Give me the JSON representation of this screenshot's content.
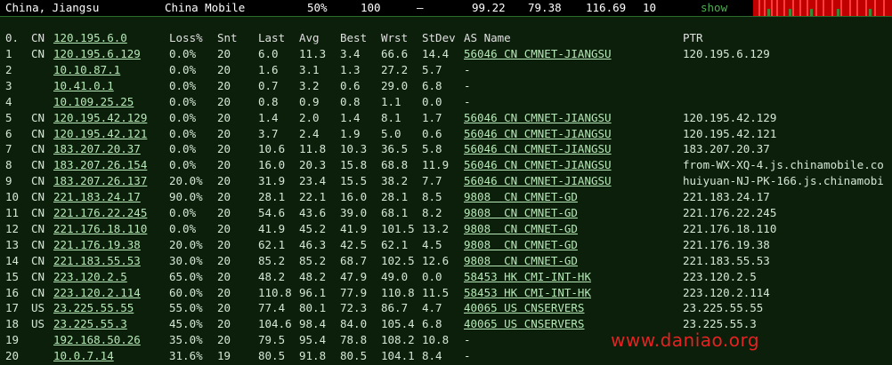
{
  "header": {
    "location": "China, Jiangsu",
    "isp": "China Mobile",
    "loss": "50%",
    "sent": "100",
    "dash": "–",
    "best": "99.22",
    "avg": "79.38",
    "worst": "116.69",
    "hops": "10",
    "show_label": "show"
  },
  "columns": [
    "0.",
    "CN",
    "120.195.6.0",
    "Loss%",
    "Snt",
    "Last",
    "Avg",
    "Best",
    "Wrst",
    "StDev",
    "AS Name",
    "PTR"
  ],
  "rows": [
    {
      "n": "1",
      "cc": "CN",
      "ip": "120.195.6.129",
      "loss": "0.0%",
      "snt": "20",
      "last": "6.0",
      "avg": "11.3",
      "best": "3.4",
      "wrst": "66.6",
      "stdev": "14.4",
      "as": "56046 CN CMNET-JIANGSU",
      "ptr": "120.195.6.129"
    },
    {
      "n": "2",
      "cc": "",
      "ip": "10.10.87.1",
      "loss": "0.0%",
      "snt": "20",
      "last": "1.6",
      "avg": "3.1",
      "best": "1.3",
      "wrst": "27.2",
      "stdev": "5.7",
      "as": "-",
      "ptr": ""
    },
    {
      "n": "3",
      "cc": "",
      "ip": "10.41.0.1",
      "loss": "0.0%",
      "snt": "20",
      "last": "0.7",
      "avg": "3.2",
      "best": "0.6",
      "wrst": "29.0",
      "stdev": "6.8",
      "as": "-",
      "ptr": ""
    },
    {
      "n": "4",
      "cc": "",
      "ip": "10.109.25.25",
      "loss": "0.0%",
      "snt": "20",
      "last": "0.8",
      "avg": "0.9",
      "best": "0.8",
      "wrst": "1.1",
      "stdev": "0.0",
      "as": "-",
      "ptr": ""
    },
    {
      "n": "5",
      "cc": "CN",
      "ip": "120.195.42.129",
      "loss": "0.0%",
      "snt": "20",
      "last": "1.4",
      "avg": "2.0",
      "best": "1.4",
      "wrst": "8.1",
      "stdev": "1.7",
      "as": "56046 CN CMNET-JIANGSU",
      "ptr": "120.195.42.129"
    },
    {
      "n": "6",
      "cc": "CN",
      "ip": "120.195.42.121",
      "loss": "0.0%",
      "snt": "20",
      "last": "3.7",
      "avg": "2.4",
      "best": "1.9",
      "wrst": "5.0",
      "stdev": "0.6",
      "as": "56046 CN CMNET-JIANGSU",
      "ptr": "120.195.42.121"
    },
    {
      "n": "7",
      "cc": "CN",
      "ip": "183.207.20.37",
      "loss": "0.0%",
      "snt": "20",
      "last": "10.6",
      "avg": "11.8",
      "best": "10.3",
      "wrst": "36.5",
      "stdev": "5.8",
      "as": "56046 CN CMNET-JIANGSU",
      "ptr": "183.207.20.37"
    },
    {
      "n": "8",
      "cc": "CN",
      "ip": "183.207.26.154",
      "loss": "0.0%",
      "snt": "20",
      "last": "16.0",
      "avg": "20.3",
      "best": "15.8",
      "wrst": "68.8",
      "stdev": "11.9",
      "as": "56046 CN CMNET-JIANGSU",
      "ptr": "from-WX-XQ-4.js.chinamobile.co"
    },
    {
      "n": "9",
      "cc": "CN",
      "ip": "183.207.26.137",
      "loss": "20.0%",
      "snt": "20",
      "last": "31.9",
      "avg": "23.4",
      "best": "15.5",
      "wrst": "38.2",
      "stdev": "7.7",
      "as": "56046 CN CMNET-JIANGSU",
      "ptr": "huiyuan-NJ-PK-166.js.chinamobi"
    },
    {
      "n": "10",
      "cc": "CN",
      "ip": "221.183.24.17",
      "loss": "90.0%",
      "snt": "20",
      "last": "28.1",
      "avg": "22.1",
      "best": "16.0",
      "wrst": "28.1",
      "stdev": "8.5",
      "as": "9808  CN CMNET-GD",
      "ptr": "221.183.24.17"
    },
    {
      "n": "11",
      "cc": "CN",
      "ip": "221.176.22.245",
      "loss": "0.0%",
      "snt": "20",
      "last": "54.6",
      "avg": "43.6",
      "best": "39.0",
      "wrst": "68.1",
      "stdev": "8.2",
      "as": "9808  CN CMNET-GD",
      "ptr": "221.176.22.245"
    },
    {
      "n": "12",
      "cc": "CN",
      "ip": "221.176.18.110",
      "loss": "0.0%",
      "snt": "20",
      "last": "41.9",
      "avg": "45.2",
      "best": "41.9",
      "wrst": "101.5",
      "stdev": "13.2",
      "as": "9808  CN CMNET-GD",
      "ptr": "221.176.18.110"
    },
    {
      "n": "13",
      "cc": "CN",
      "ip": "221.176.19.38",
      "loss": "20.0%",
      "snt": "20",
      "last": "62.1",
      "avg": "46.3",
      "best": "42.5",
      "wrst": "62.1",
      "stdev": "4.5",
      "as": "9808  CN CMNET-GD",
      "ptr": "221.176.19.38"
    },
    {
      "n": "14",
      "cc": "CN",
      "ip": "221.183.55.53",
      "loss": "30.0%",
      "snt": "20",
      "last": "85.2",
      "avg": "85.2",
      "best": "68.7",
      "wrst": "102.5",
      "stdev": "12.6",
      "as": "9808  CN CMNET-GD",
      "ptr": "221.183.55.53"
    },
    {
      "n": "15",
      "cc": "CN",
      "ip": "223.120.2.5",
      "loss": "65.0%",
      "snt": "20",
      "last": "48.2",
      "avg": "48.2",
      "best": "47.9",
      "wrst": "49.0",
      "stdev": "0.0",
      "as": "58453 HK CMI-INT-HK",
      "ptr": "223.120.2.5"
    },
    {
      "n": "16",
      "cc": "CN",
      "ip": "223.120.2.114",
      "loss": "60.0%",
      "snt": "20",
      "last": "110.8",
      "avg": "96.1",
      "best": "77.9",
      "wrst": "110.8",
      "stdev": "11.5",
      "as": "58453 HK CMI-INT-HK",
      "ptr": "223.120.2.114"
    },
    {
      "n": "17",
      "cc": "US",
      "ip": "23.225.55.55",
      "loss": "55.0%",
      "snt": "20",
      "last": "77.4",
      "avg": "80.1",
      "best": "72.3",
      "wrst": "86.7",
      "stdev": "4.7",
      "as": "40065 US CNSERVERS",
      "ptr": "23.225.55.55"
    },
    {
      "n": "18",
      "cc": "US",
      "ip": "23.225.55.3",
      "loss": "45.0%",
      "snt": "20",
      "last": "104.6",
      "avg": "98.4",
      "best": "84.0",
      "wrst": "105.4",
      "stdev": "6.8",
      "as": "40065 US CNSERVERS",
      "ptr": "23.225.55.3"
    },
    {
      "n": "19",
      "cc": "",
      "ip": "192.168.50.26",
      "loss": "35.0%",
      "snt": "20",
      "last": "79.5",
      "avg": "95.4",
      "best": "78.8",
      "wrst": "108.2",
      "stdev": "10.8",
      "as": "-",
      "ptr": ""
    },
    {
      "n": "20",
      "cc": "",
      "ip": "10.0.7.14",
      "loss": "31.6%",
      "snt": "19",
      "last": "80.5",
      "avg": "91.8",
      "best": "80.5",
      "wrst": "104.1",
      "stdev": "8.4",
      "as": "-",
      "ptr": ""
    }
  ],
  "watermark": "www.daniao.org",
  "colors": {
    "background": "#0b1f0b",
    "spark_red": "#c00000",
    "spark_green": "#3a8a3a",
    "watermark": "#e52222"
  }
}
